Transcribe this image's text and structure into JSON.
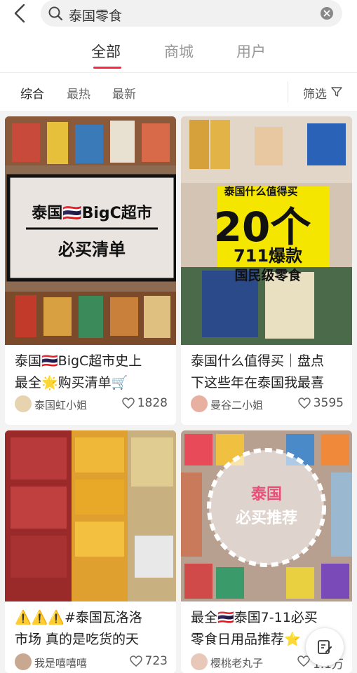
{
  "search": {
    "query": "泰国零食"
  },
  "tabs": [
    {
      "label": "全部",
      "active": true
    },
    {
      "label": "商城",
      "active": false
    },
    {
      "label": "用户",
      "active": false
    }
  ],
  "sort": {
    "options": [
      "综合",
      "最热",
      "最新"
    ],
    "selected": "综合",
    "filter_label": "筛选"
  },
  "accent_color": "#ff2442",
  "cards": [
    {
      "cover_text": [
        "泰国🇹🇭BigC超市",
        "必买清单"
      ],
      "title_lines": [
        "泰国🇹🇭BigC超市史上",
        "最全🌟购买清单🛒"
      ],
      "author": "泰国虹小姐",
      "likes": "1828"
    },
    {
      "cover_text": [
        "泰国什么值得买",
        "20个",
        "711爆款",
        "国民级零食"
      ],
      "title_lines": [
        "泰国什么值得买｜盘点",
        "下这些年在泰国我最喜"
      ],
      "author": "曼谷二小姐",
      "likes": "3595"
    },
    {
      "cover_text": [],
      "title_lines": [
        "⚠️⚠️⚠️#泰国瓦洛洛",
        "市场 真的是吃货的天"
      ],
      "author": "我是嘻嘻嘻",
      "likes": "723"
    },
    {
      "cover_text": [
        "泰国",
        "必买推荐"
      ],
      "title_lines": [
        "最全🇹🇭泰国7-11必买",
        "零食日用品推荐⭐"
      ],
      "author": "樱桃老丸子",
      "likes": "1.1万"
    }
  ]
}
